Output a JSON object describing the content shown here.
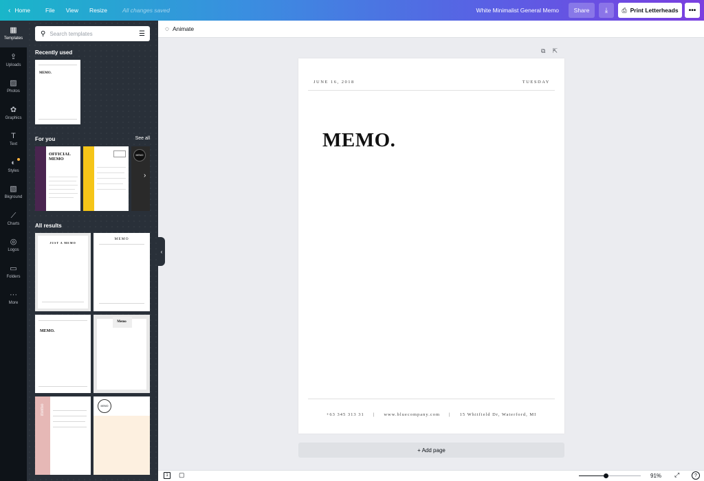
{
  "topbar": {
    "home": "Home",
    "file": "File",
    "view": "View",
    "resize": "Resize",
    "saved_status": "All changes saved",
    "doc_title": "White Minimalist General Memo",
    "share": "Share",
    "print": "Print Letterheads"
  },
  "rail": {
    "items": [
      {
        "label": "Templates",
        "icon": "templates-icon"
      },
      {
        "label": "Uploads",
        "icon": "upload-icon"
      },
      {
        "label": "Photos",
        "icon": "photo-icon"
      },
      {
        "label": "Graphics",
        "icon": "graphics-icon"
      },
      {
        "label": "Text",
        "icon": "text-icon"
      },
      {
        "label": "Styles",
        "icon": "palette-icon"
      },
      {
        "label": "Bkground",
        "icon": "background-icon"
      },
      {
        "label": "Charts",
        "icon": "chart-icon"
      },
      {
        "label": "Logos",
        "icon": "logo-icon"
      },
      {
        "label": "Folders",
        "icon": "folder-icon"
      },
      {
        "label": "More",
        "icon": "more-icon"
      }
    ]
  },
  "panel": {
    "search_placeholder": "Search templates",
    "recently_used": "Recently used",
    "for_you": "For you",
    "see_all": "See all",
    "all_results": "All results",
    "recent_thumb_title": "MEMO.",
    "for_you_titles": [
      "OFFICIAL MEMO",
      "",
      "MEMO"
    ],
    "result_titles": [
      "JUST A MEMO",
      "MEMO",
      "MEMO.",
      "Memo",
      "memo",
      "MEMO"
    ]
  },
  "toolbar": {
    "animate": "Animate"
  },
  "page": {
    "date": "JUNE 16, 2018",
    "day": "TUESDAY",
    "title": "MEMO.",
    "phone": "+63 345 313 31",
    "website": "www.bluecompany.com",
    "address": "15 Whitfield Dr, Waterford, MI"
  },
  "add_page": "+ Add page",
  "bottombar": {
    "page_count": "1",
    "zoom": "91%",
    "zoom_fraction": 0.44
  }
}
